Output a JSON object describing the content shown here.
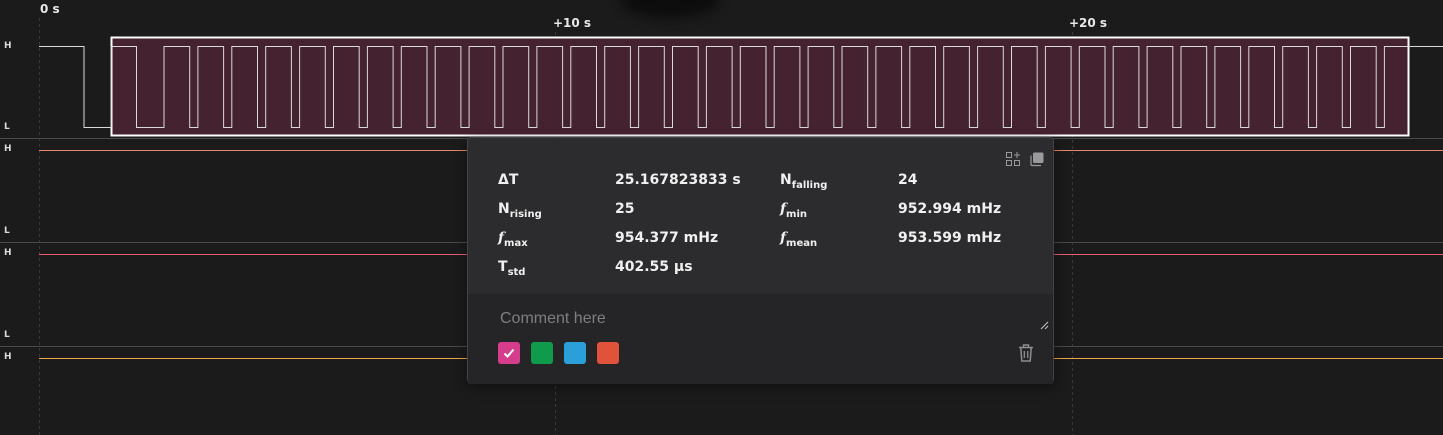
{
  "ruler": {
    "labels": [
      "0 s",
      "+10 s",
      "+20 s"
    ]
  },
  "channels": [
    {
      "high_label": "H",
      "low_label": "L",
      "color": "#d9d9d9"
    },
    {
      "high_label": "H",
      "low_label": "L",
      "color": "#e8876a"
    },
    {
      "high_label": "H",
      "low_label": "L",
      "color": "#e85d75"
    },
    {
      "high_label": "H",
      "color": "#f0a64a"
    }
  ],
  "selection": {
    "fill_color": "#45222f",
    "border_color": "#ffffff"
  },
  "measurement_popup": {
    "stats": [
      {
        "label": "ΔT",
        "subscript": "",
        "value": "25.167823833 s"
      },
      {
        "label": "N",
        "subscript": "falling",
        "value": "24"
      },
      {
        "label": "N",
        "subscript": "rising",
        "value": "25"
      },
      {
        "label": "f",
        "subscript": "min",
        "value": "952.994 mHz"
      },
      {
        "label": "f",
        "subscript": "max",
        "value": "954.377 mHz"
      },
      {
        "label": "f",
        "subscript": "mean",
        "value": "953.599 mHz"
      },
      {
        "label": "T",
        "subscript": "std",
        "value": "402.55 µs"
      }
    ],
    "comment": {
      "value": "",
      "placeholder": "Comment here"
    },
    "colors": [
      {
        "name": "pink",
        "hex": "#d63c8c",
        "selected": true
      },
      {
        "name": "green",
        "hex": "#0f9b4b",
        "selected": false
      },
      {
        "name": "blue",
        "hex": "#2a9fd8",
        "selected": false
      },
      {
        "name": "red",
        "hex": "#e0523a",
        "selected": false
      }
    ],
    "icons": [
      "layout-icon",
      "copy-icon",
      "trash-icon",
      "check-icon",
      "resize-handle-icon"
    ]
  }
}
